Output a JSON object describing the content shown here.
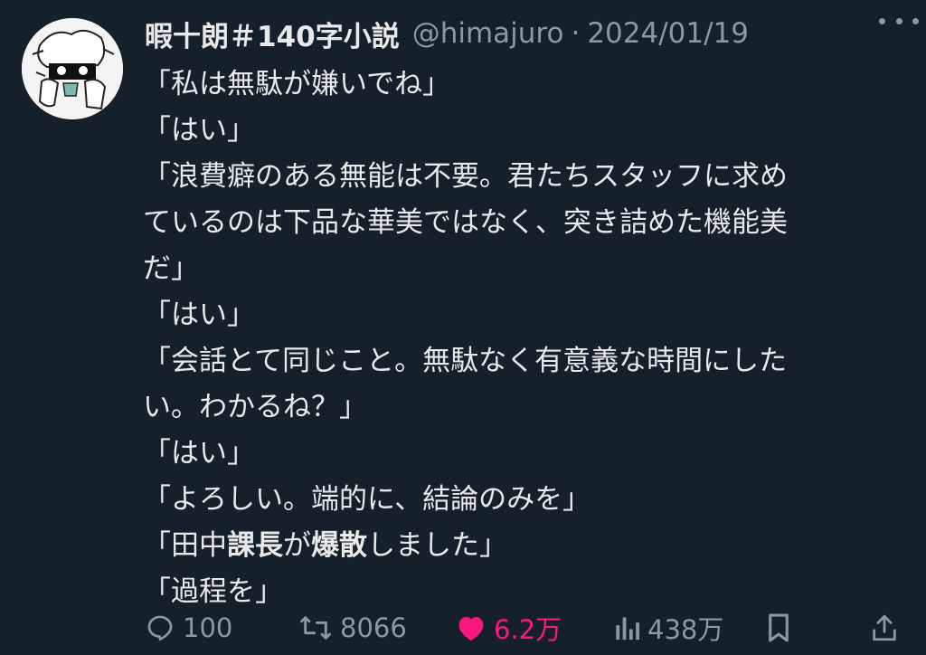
{
  "tweet": {
    "author": "暇十朗＃140字小説",
    "handle": "@himajuro",
    "separator": "·",
    "date": "2024/01/19",
    "lines": [
      [
        {
          "t": "「私は無駄が嫌いでね」"
        }
      ],
      [
        {
          "t": "「はい」"
        }
      ],
      [
        {
          "t": "「浪費癖のある無能は不要。君たちスタッフに求め"
        }
      ],
      [
        {
          "t": "ているのは下品な華美ではなく、突き詰めた機能美"
        }
      ],
      [
        {
          "t": "だ」"
        }
      ],
      [
        {
          "t": "「はい」"
        }
      ],
      [
        {
          "t": "「会話とて同じこと。無駄なく有意義な時間にした"
        }
      ],
      [
        {
          "t": "い。わかるね？」"
        }
      ],
      [
        {
          "t": "「はい」"
        }
      ],
      [
        {
          "t": "「よろしい。端的に、結論のみを」"
        }
      ],
      [
        {
          "t": "「田中"
        },
        {
          "t": "課長",
          "b": true
        },
        {
          "t": "が"
        },
        {
          "t": "爆散",
          "b": true
        },
        {
          "t": "しました」"
        }
      ],
      [
        {
          "t": "「過程を」"
        }
      ]
    ]
  },
  "actions": {
    "reply_count": "100",
    "retweet_count": "8066",
    "like_count": "6.2万",
    "view_count": "438万"
  },
  "icons": {
    "reply": "speech-bubble-icon",
    "retweet": "retweet-arrows-icon",
    "like": "heart-icon",
    "views": "bar-chart-icon",
    "bookmark": "bookmark-icon",
    "share": "share-upload-icon",
    "more": "ellipsis-icon"
  },
  "colors": {
    "background": "#15202b",
    "text": "#e7e9ea",
    "muted": "#8b98a5",
    "like": "#f91880"
  }
}
